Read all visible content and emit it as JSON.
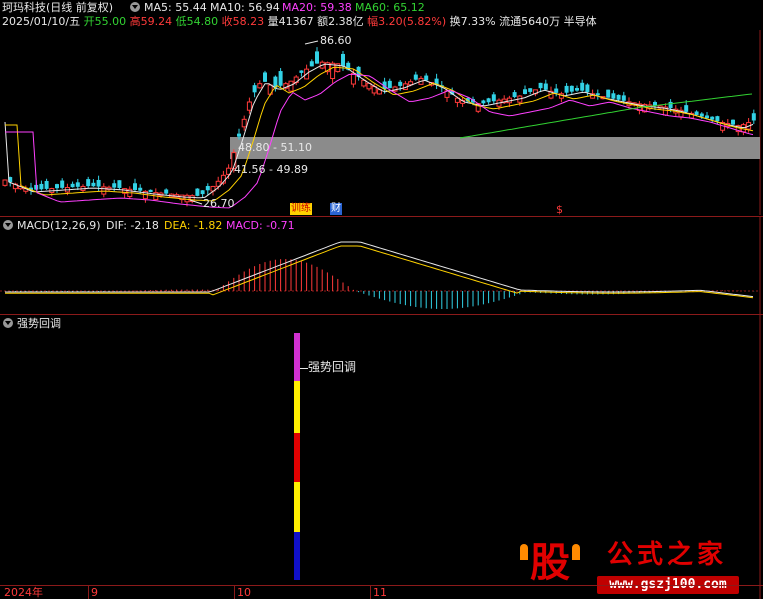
{
  "header": {
    "title": "珂玛科技(日线 前复权)",
    "ma": [
      {
        "label": "MA5: 55.44",
        "color": "#e8e8e8"
      },
      {
        "label": "MA10: 56.94",
        "color": "#e8e8e8"
      },
      {
        "label": "MA20: 59.38",
        "color": "#ff40ff"
      },
      {
        "label": "MA60: 65.12",
        "color": "#32d232"
      }
    ]
  },
  "quote": {
    "date": "2025/01/10/五",
    "open_label": "开",
    "open": "55.00",
    "high_label": "高",
    "high": "59.24",
    "low_label": "低",
    "low": "54.80",
    "close_label": "收",
    "close": "58.23",
    "vol_label": "量",
    "vol": "41367",
    "amount_label": "额",
    "amount": "2.38亿",
    "change_label": "幅",
    "change": "3.20(5.82%)",
    "turnover_label": "换",
    "turnover": "7.33%",
    "float_label": "流通",
    "float": "5640万",
    "sector": "半导体"
  },
  "price_panel": {
    "high_marker": "86.60",
    "low_marker": "26.70",
    "box_label1": "48.80 - 51.10",
    "box_label2": "41.56 - 49.89",
    "event1": "训练",
    "event2": "财",
    "event3": "$"
  },
  "macd": {
    "title": "MACD(12,26,9)",
    "dif": "DIF: -2.18",
    "dea": "DEA: -1.82",
    "macd": "MACD: -0.71"
  },
  "indicator": {
    "title": "强势回调",
    "signal_label": "强势回调"
  },
  "time_axis": {
    "labels": [
      "2024年",
      "9",
      "10",
      "11"
    ]
  },
  "watermark": {
    "logo_char": "股",
    "title": "公式之家",
    "url": "www.gszj100.com"
  },
  "colors": {
    "up": "#ff3a3a",
    "down": "#32d2e6",
    "ma20": "#ff40ff",
    "ma60": "#32d232",
    "divider": "#8b1a1a"
  }
}
